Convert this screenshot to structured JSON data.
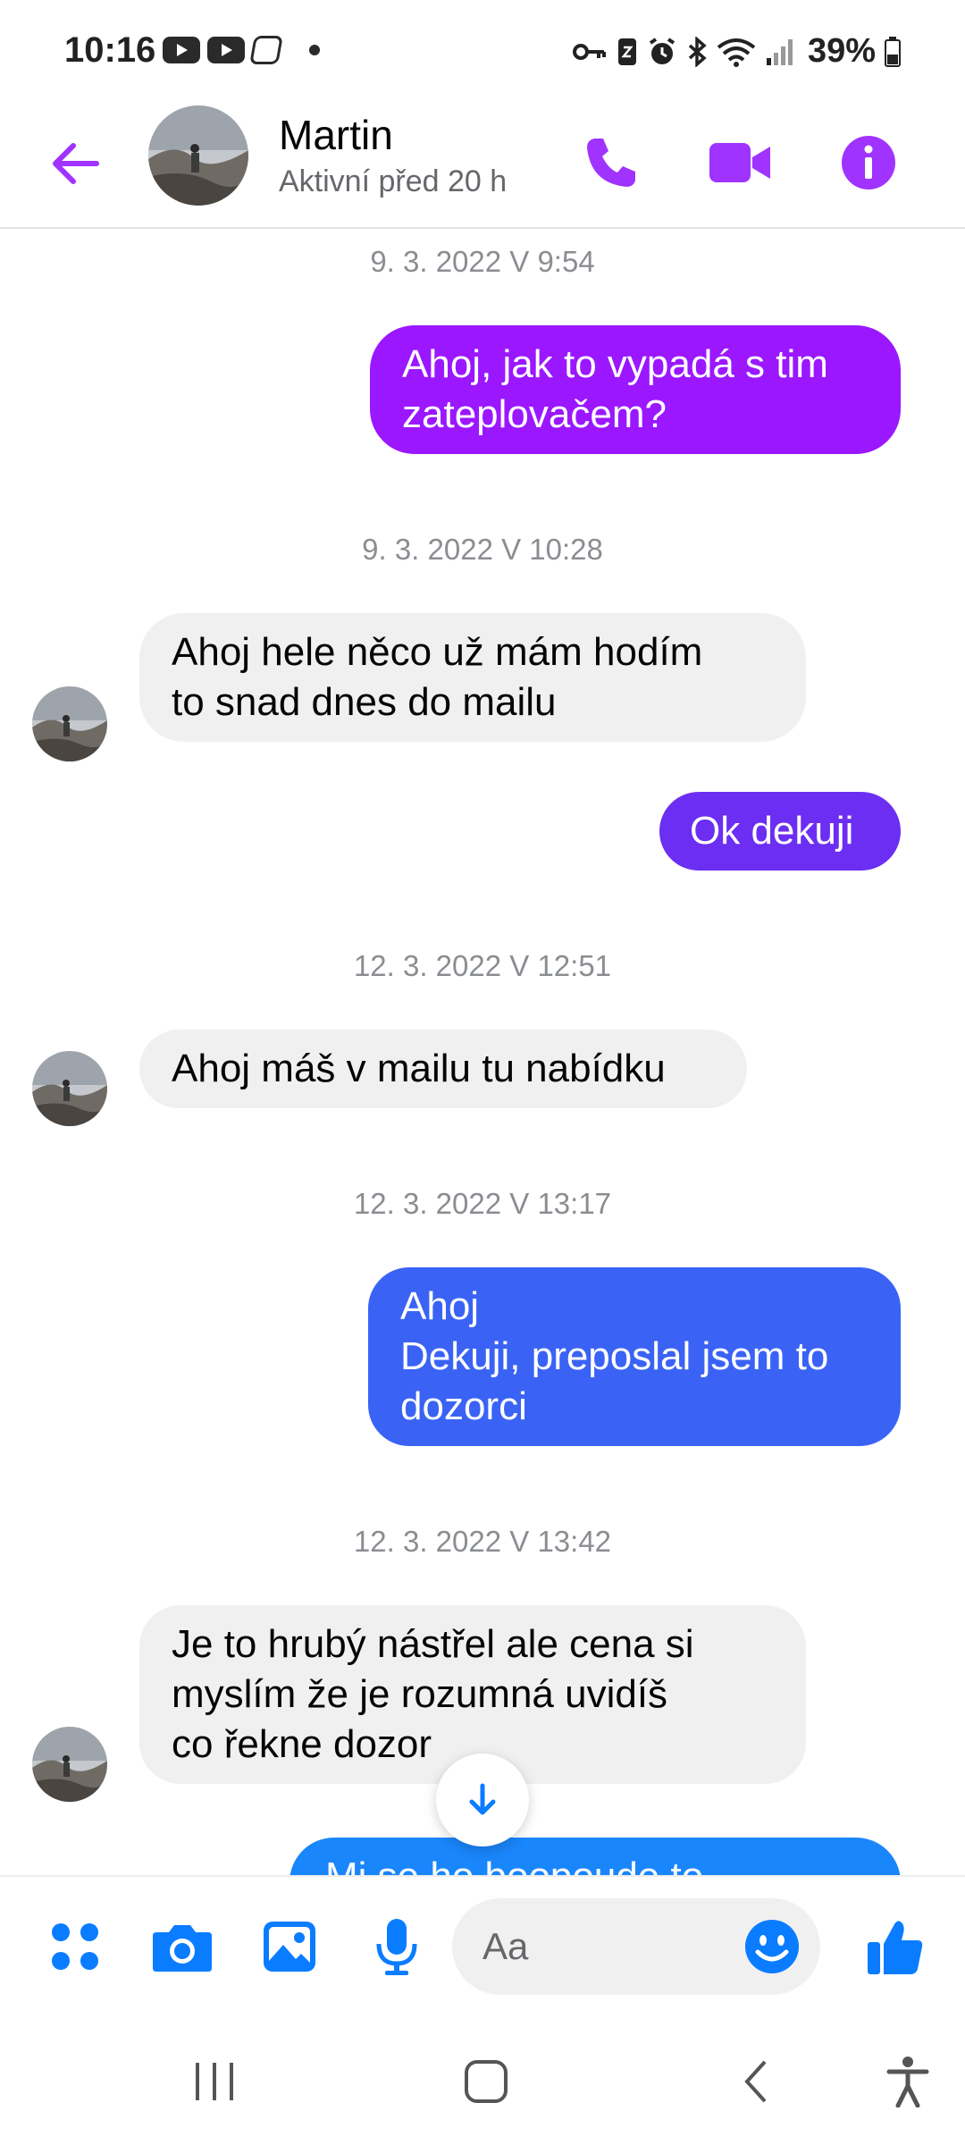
{
  "status_bar": {
    "time": "10:16",
    "battery": "39%"
  },
  "header": {
    "contact_name": "Martin",
    "contact_status": "Aktivní před 20 h"
  },
  "colors": {
    "accent_purple": "#a033ff",
    "bubble_1": "#9b17ff",
    "bubble_2": "#6c2ef2",
    "bubble_3": "#3a63f5",
    "bubble_4": "#1a86fb",
    "messenger_blue": "#0a7cff",
    "incoming_bg": "#f0f0f0"
  },
  "messages": [
    {
      "type": "timestamp",
      "text": "9. 3. 2022 V 9:54"
    },
    {
      "type": "outgoing",
      "lines": [
        "Ahoj, jak to vypadá s tim",
        "zateplovačem?"
      ]
    },
    {
      "type": "timestamp",
      "text": "9. 3. 2022 V 10:28"
    },
    {
      "type": "incoming",
      "lines": [
        "Ahoj hele něco už mám hodím",
        "to snad dnes do mailu"
      ]
    },
    {
      "type": "outgoing",
      "lines": [
        "Ok dekuji"
      ]
    },
    {
      "type": "timestamp",
      "text": "12. 3. 2022 V 12:51"
    },
    {
      "type": "incoming",
      "lines": [
        "Ahoj máš v mailu tu nabídku"
      ]
    },
    {
      "type": "timestamp",
      "text": "12. 3. 2022 V 13:17"
    },
    {
      "type": "outgoing",
      "lines": [
        "Ahoj",
        "Dekuji, preposlal jsem to",
        "dozorci"
      ]
    },
    {
      "type": "timestamp",
      "text": "12. 3. 2022 V 13:42"
    },
    {
      "type": "incoming",
      "lines": [
        "Je to hrubý nástřel ale cena si",
        "myslím že je rozumná uvidíš",
        "co řekne dozor"
      ]
    },
    {
      "type": "outgoing",
      "lines": [
        "Mi se ho boopoude to"
      ]
    }
  ],
  "composer": {
    "placeholder": "Aa"
  },
  "icons": {
    "back": "arrow-left-icon",
    "call": "phone-icon",
    "video": "video-camera-icon",
    "info": "info-icon",
    "menu": "four-dots-icon",
    "camera": "camera-icon",
    "gallery": "image-icon",
    "mic": "microphone-icon",
    "emoji": "smiley-icon",
    "like": "thumbs-up-icon",
    "scroll": "arrow-down-icon"
  }
}
